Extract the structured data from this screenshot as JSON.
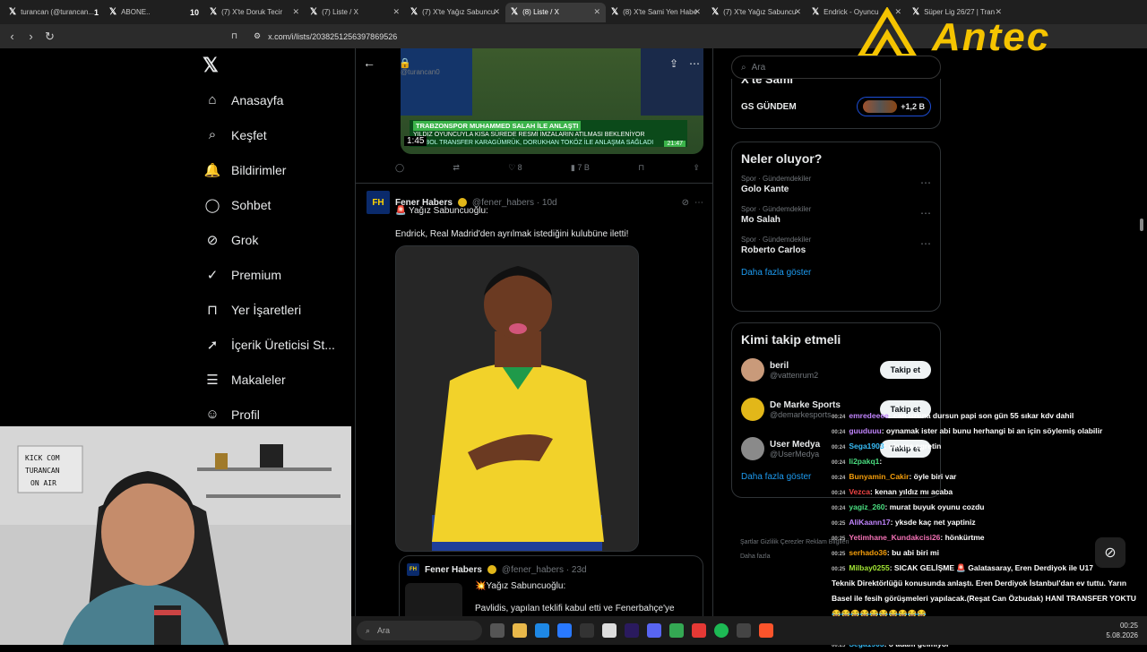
{
  "browser": {
    "tabs": [
      {
        "label": "turancan (@turancan...",
        "badge": "1"
      },
      {
        "label": "ABONE..",
        "badge": "10"
      },
      {
        "label": "(7) X'te Doruk Tecir"
      },
      {
        "label": "(7) Liste / X"
      },
      {
        "label": "(7) X'te Yağız Sabuncu"
      },
      {
        "label": "(8) Liste / X"
      },
      {
        "label": "(8) X'te Sami Yen Habe"
      },
      {
        "label": "(7) X'te Yağız Sabuncu"
      },
      {
        "label": "Endrick - Oyuncu"
      },
      {
        "label": "Süper Lig 26/27 | Tran"
      }
    ],
    "url": "x.com/i/lists/2038251256397869526"
  },
  "overlay": {
    "logo_text": "Antec"
  },
  "nav": {
    "logo": "𝕏",
    "items": [
      {
        "label": "Anasayfa",
        "icon": "⌂"
      },
      {
        "label": "Keşfet",
        "icon": "⌕"
      },
      {
        "label": "Bildirimler",
        "icon": "🔔",
        "badge": "8"
      },
      {
        "label": "Sohbet",
        "icon": "◯"
      },
      {
        "label": "Grok",
        "icon": "⊘"
      },
      {
        "label": "Premium",
        "icon": "✓"
      },
      {
        "label": "Yer İşaretleri",
        "icon": "⊓"
      },
      {
        "label": "İçerik Üreticisi St...",
        "icon": "➚"
      },
      {
        "label": "Makaleler",
        "icon": "☰"
      },
      {
        "label": "Profil",
        "icon": "☺"
      }
    ]
  },
  "feed": {
    "header_handle": "@turancan0",
    "video": {
      "headline": "TRABZONSPOR MUHAMMED SALAH İLE ANLAŞTI",
      "subline": "YILDIZ OYUNCUYLA KISA SÜREDE RESMİ İMZALARIN ATILMASI BEKLENİYOR",
      "ticker": "FUTBOL TRANSFER  KARAGÜMRÜK, DORUKHAN TOKÖZ İLE ANLAŞMA SAĞLADI",
      "time": "1:45",
      "clock": "21:47"
    },
    "actions": {
      "likes": "8",
      "views": "7 B"
    },
    "tweet": {
      "author": "Fener Habers",
      "handle": "@fener_habers · 10d",
      "line1": "🚨 Yağız Sabuncuoğlu:",
      "line2": "Endrick, Real Madrid'den ayrılmak istediğini kulubüne iletti!"
    },
    "quote": {
      "author": "Fener Habers",
      "handle": "@fener_habers · 23d",
      "line1": "💥Yağız Sabuncuoğlu:",
      "line2": "Pavlidis, yapılan teklifi kabul etti ve Fenerbahçe'ye"
    }
  },
  "right": {
    "search_placeholder": "Ara",
    "top_card": {
      "title": "X'te Sami",
      "name": "GS GÜNDEM",
      "count": "+1,2 B"
    },
    "trends": {
      "title": "Neler oluyor?",
      "items": [
        {
          "cat": "Spor · Gündemdekiler",
          "name": "Golo Kante"
        },
        {
          "cat": "Spor · Gündemdekiler",
          "name": "Mo Salah"
        },
        {
          "cat": "Spor · Gündemdekiler",
          "name": "Roberto Carlos"
        }
      ],
      "more": "Daha fazla göster"
    },
    "follow": {
      "title": "Kimi takip etmeli",
      "items": [
        {
          "name": "beril",
          "handle": "@vattenrum2",
          "btn": "Takip et"
        },
        {
          "name": "De Marke Sports",
          "handle": "@demarkesports",
          "btn": "Takip et"
        },
        {
          "name": "User Medya",
          "handle": "@UserMedya",
          "btn": "Takip et"
        }
      ],
      "more": "Daha fazla göster"
    },
    "footer": "Şartlar   Gizlilik   Çerezler   Reklam Bilgileri   Daha fazla"
  },
  "webcam": {
    "sign_lines": [
      "KICK COM",
      "TURANCAN",
      "ON AIR"
    ]
  },
  "chat": [
    {
      "t": "00:24",
      "user": "emredeeee",
      "color": "#c084fc",
      "msg": ": can uzuna dursun papi son gün 55 sıkar kdv dahil"
    },
    {
      "t": "00:24",
      "user": "guuduuu",
      "color": "#c084fc",
      "msg": ": oynamak ister abi bunu herhangi bi an için söylemiş olabilir"
    },
    {
      "t": "00:24",
      "user": "Sega1903",
      "color": "#38bdf8",
      "msg": ": okuma ogretin"
    },
    {
      "t": "00:24",
      "user": "li2pakq1",
      "color": "#4ade80",
      "msg": ":"
    },
    {
      "t": "00:24",
      "user": "Bunyamin_Cakir",
      "color": "#f59e0b",
      "msg": ": öyle biri var"
    },
    {
      "t": "00:24",
      "user": "Vezca",
      "color": "#ef4444",
      "msg": ": kenan yıldız mı acaba"
    },
    {
      "t": "00:24",
      "user": "yagiz_260",
      "color": "#4ade80",
      "msg": ": murat buyuk oyunu cozdu"
    },
    {
      "t": "00:25",
      "user": "AliKaann17",
      "color": "#c084fc",
      "msg": ": yksde kaç net yaptiniz"
    },
    {
      "t": "00:25",
      "user": "Yetimhane_Kundakcisi26",
      "color": "#f472b6",
      "msg": ": hönkürtme"
    },
    {
      "t": "00:25",
      "user": "serhado36",
      "color": "#f59e0b",
      "msg": ": bu abi biri mi"
    },
    {
      "t": "00:25",
      "user": "Milbay0255",
      "color": "#a3e635",
      "msg": ": SICAK GELİŞME 🚨 Galatasaray, Eren Derdiyok ile U17"
    },
    {
      "t": "",
      "user": "",
      "color": "#fff",
      "msg": "Teknik Direktörlüğü konusunda anlaştı. Eren Derdiyok İstanbul'dan ev tuttu. Yarın"
    },
    {
      "t": "",
      "user": "",
      "color": "#fff",
      "msg": "Basel ile fesih görüşmeleri yapılacak.(Reşat Can Özbudak) HANİ TRANSFER YOKTU"
    },
    {
      "t": "",
      "user": "",
      "color": "#fff",
      "msg": "😂😂😂😂😂😂😂😂😂😂"
    },
    {
      "t": "00:25",
      "user": "lllxxKNightTR",
      "color": "#c084fc",
      "msg": ": iq test yapmak makina bozulur"
    },
    {
      "t": "00:25",
      "user": "Sega1903",
      "color": "#38bdf8",
      "msg": ": o adam gelmiyor"
    }
  ],
  "taskbar": {
    "search": "Ara",
    "time": "00:25",
    "date": "5.08.2026"
  }
}
